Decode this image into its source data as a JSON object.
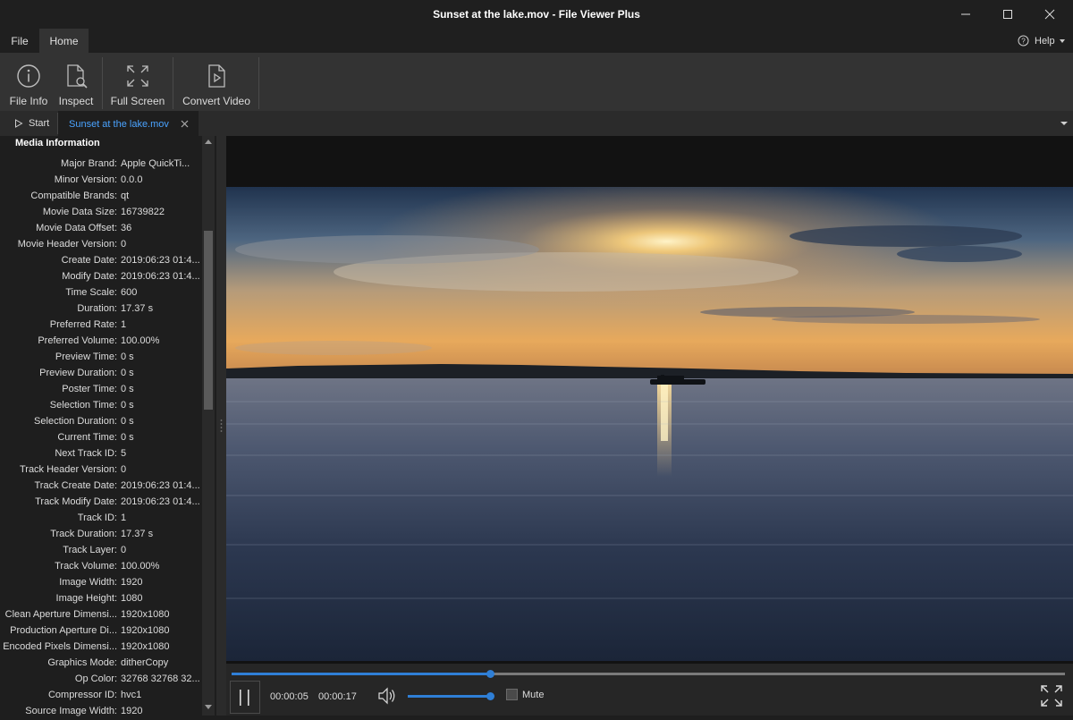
{
  "window": {
    "title": "Sunset at the lake.mov - File Viewer Plus"
  },
  "menu": {
    "file": "File",
    "home": "Home",
    "help": "Help"
  },
  "ribbon": {
    "file_info": "File Info",
    "inspect": "Inspect",
    "full_screen": "Full Screen",
    "convert_video": "Convert Video"
  },
  "tabs": {
    "start": "Start",
    "file": "Sunset at the lake.mov"
  },
  "panel": {
    "section_title": "Media Information",
    "properties": [
      {
        "k": "Major Brand:",
        "v": "Apple QuickTi..."
      },
      {
        "k": "Minor Version:",
        "v": "0.0.0"
      },
      {
        "k": "Compatible Brands:",
        "v": "qt"
      },
      {
        "k": "Movie Data Size:",
        "v": "16739822"
      },
      {
        "k": "Movie Data Offset:",
        "v": "36"
      },
      {
        "k": "Movie Header Version:",
        "v": "0"
      },
      {
        "k": "Create Date:",
        "v": "2019:06:23 01:4..."
      },
      {
        "k": "Modify Date:",
        "v": "2019:06:23 01:4..."
      },
      {
        "k": "Time Scale:",
        "v": "600"
      },
      {
        "k": "Duration:",
        "v": "17.37 s"
      },
      {
        "k": "Preferred Rate:",
        "v": "1"
      },
      {
        "k": "Preferred Volume:",
        "v": "100.00%"
      },
      {
        "k": "Preview Time:",
        "v": "0 s"
      },
      {
        "k": "Preview Duration:",
        "v": "0 s"
      },
      {
        "k": "Poster Time:",
        "v": "0 s"
      },
      {
        "k": "Selection Time:",
        "v": "0 s"
      },
      {
        "k": "Selection Duration:",
        "v": "0 s"
      },
      {
        "k": "Current Time:",
        "v": "0 s"
      },
      {
        "k": "Next Track ID:",
        "v": "5"
      },
      {
        "k": "Track Header Version:",
        "v": "0"
      },
      {
        "k": "Track Create Date:",
        "v": "2019:06:23 01:4..."
      },
      {
        "k": "Track Modify Date:",
        "v": "2019:06:23 01:4..."
      },
      {
        "k": "Track ID:",
        "v": "1"
      },
      {
        "k": "Track Duration:",
        "v": "17.37 s"
      },
      {
        "k": "Track Layer:",
        "v": "0"
      },
      {
        "k": "Track Volume:",
        "v": "100.00%"
      },
      {
        "k": "Image Width:",
        "v": "1920"
      },
      {
        "k": "Image Height:",
        "v": "1080"
      },
      {
        "k": "Clean Aperture Dimensi...",
        "v": "1920x1080"
      },
      {
        "k": "Production Aperture Di...",
        "v": "1920x1080"
      },
      {
        "k": "Encoded Pixels Dimensi...",
        "v": "1920x1080"
      },
      {
        "k": "Graphics Mode:",
        "v": "ditherCopy"
      },
      {
        "k": "Op Color:",
        "v": "32768 32768 32..."
      },
      {
        "k": "Compressor ID:",
        "v": "hvc1"
      },
      {
        "k": "Source Image Width:",
        "v": "1920"
      }
    ]
  },
  "player": {
    "current_time": "00:00:05",
    "total_time": "00:00:17",
    "progress": 0.31,
    "volume": 1.0,
    "mute_label": "Mute",
    "muted": false
  },
  "colors": {
    "accent": "#2f7fd6",
    "active_tab_text": "#4aa3ff"
  },
  "icons": [
    "file-info-icon",
    "inspect-icon",
    "full-screen-icon",
    "convert-video-icon",
    "pause-icon",
    "volume-icon",
    "fullscreen-icon",
    "help-icon",
    "close-icon",
    "minimize-icon",
    "maximize-icon",
    "play-icon",
    "chevron-down-icon"
  ]
}
